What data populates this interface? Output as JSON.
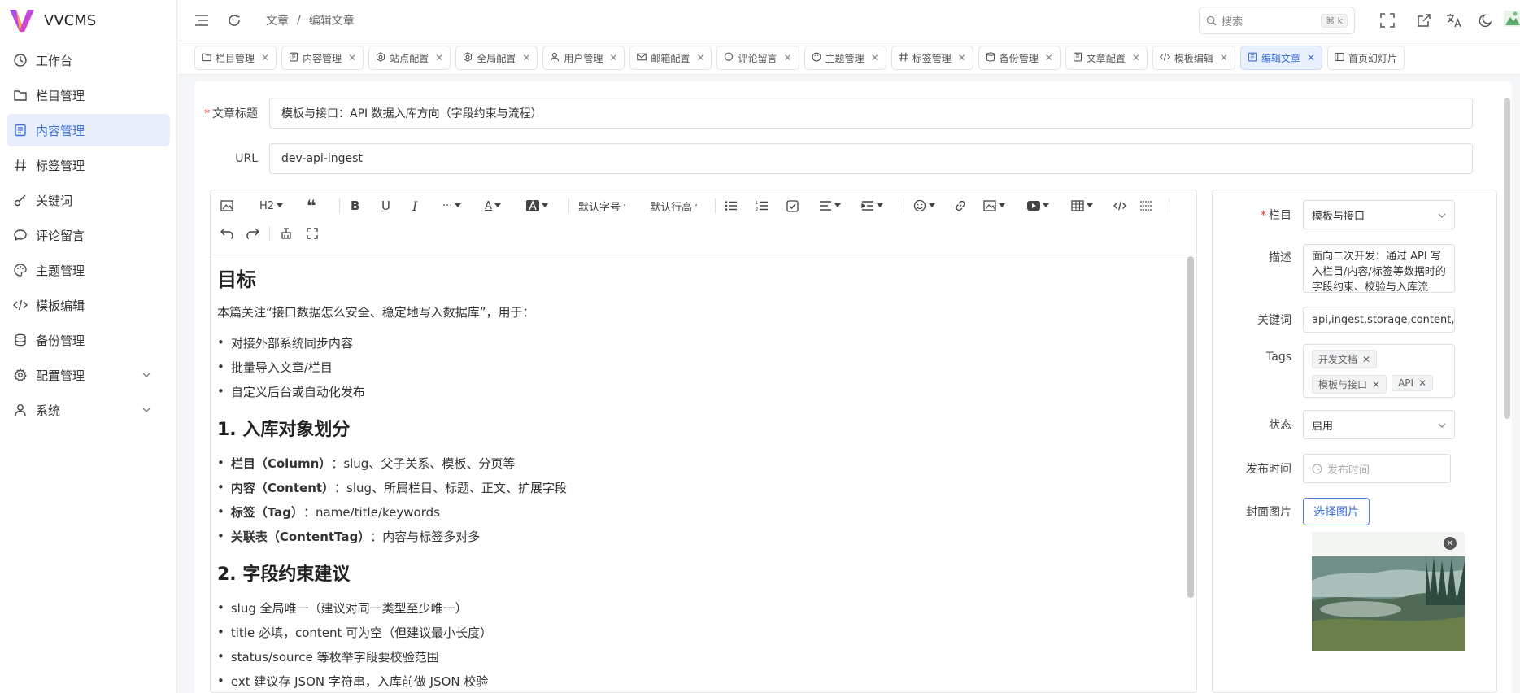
{
  "app": {
    "name": "VVCMS"
  },
  "sidebar": {
    "items": [
      {
        "label": "工作台",
        "icon": "dashboard-icon"
      },
      {
        "label": "栏目管理",
        "icon": "folder-icon"
      },
      {
        "label": "内容管理",
        "icon": "document-icon",
        "active": true
      },
      {
        "label": "标签管理",
        "icon": "hash-icon"
      },
      {
        "label": "关键词",
        "icon": "key-icon"
      },
      {
        "label": "评论留言",
        "icon": "comment-icon"
      },
      {
        "label": "主题管理",
        "icon": "palette-icon"
      },
      {
        "label": "模板编辑",
        "icon": "code-icon"
      },
      {
        "label": "备份管理",
        "icon": "database-icon"
      },
      {
        "label": "配置管理",
        "icon": "gear-icon",
        "expandable": true
      },
      {
        "label": "系统",
        "icon": "user-icon",
        "expandable": true
      }
    ]
  },
  "topbar": {
    "breadcrumb": [
      "文章",
      "编辑文章"
    ],
    "separator": "/",
    "search_placeholder": "搜索",
    "search_shortcut": "⌘ k"
  },
  "tabs": [
    {
      "label": "栏目管理"
    },
    {
      "label": "内容管理"
    },
    {
      "label": "站点配置"
    },
    {
      "label": "全局配置"
    },
    {
      "label": "用户管理"
    },
    {
      "label": "邮箱配置"
    },
    {
      "label": "评论留言"
    },
    {
      "label": "主题管理"
    },
    {
      "label": "标签管理"
    },
    {
      "label": "备份管理"
    },
    {
      "label": "文章配置"
    },
    {
      "label": "模板编辑"
    },
    {
      "label": "编辑文章",
      "active": true
    },
    {
      "label": "首页幻灯片"
    }
  ],
  "form": {
    "title_label": "文章标题",
    "title_value": "模板与接口：API 数据入库方向（字段约束与流程）",
    "url_label": "URL",
    "url_value": "dev-api-ingest"
  },
  "toolbar": {
    "heading": "H2",
    "font_size": "默认字号",
    "line_height": "默认行高"
  },
  "doc": {
    "h1": "目标",
    "intro": "本篇关注“接口数据怎么安全、稳定地写入数据库”，用于：",
    "goals": [
      "对接外部系统同步内容",
      "批量导入文章/栏目",
      "自定义后台或自动化发布"
    ],
    "h2a": "1. 入库对象划分",
    "objects": [
      {
        "bold": "栏目（Column）",
        "rest": "：slug、父子关系、模板、分页等"
      },
      {
        "bold": "内容（Content）",
        "rest": "：slug、所属栏目、标题、正文、扩展字段"
      },
      {
        "bold": "标签（Tag）",
        "rest": "：name/title/keywords"
      },
      {
        "bold": "关联表（ContentTag）",
        "rest": "：内容与标签多对多"
      }
    ],
    "h2b": "2. 字段约束建议",
    "rules": [
      "slug 全局唯一（建议对同一类型至少唯一）",
      "title 必填，content 可为空（但建议最小长度）",
      "status/source 等枚举字段要校验范围",
      "ext 建议存 JSON 字符串，入库前做 JSON 校验"
    ]
  },
  "panel": {
    "column_label": "栏目",
    "column_value": "模板与接口",
    "desc_label": "描述",
    "desc_value": "面向二次开发：通过 API 写入栏目/内容/标签等数据时的字段约束、校验与入库流程。",
    "keywords_label": "关键词",
    "keywords_value": "api,ingest,storage,content,column",
    "tags_label": "Tags",
    "tags": [
      "开发文档",
      "模板与接口",
      "API"
    ],
    "status_label": "状态",
    "status_value": "启用",
    "publish_label": "发布时间",
    "publish_placeholder": "发布时间",
    "cover_label": "封面图片",
    "cover_button": "选择图片"
  },
  "colors": {
    "accent": "#3b6fd8",
    "active_bg": "#e8eefc",
    "required": "#e33333"
  }
}
